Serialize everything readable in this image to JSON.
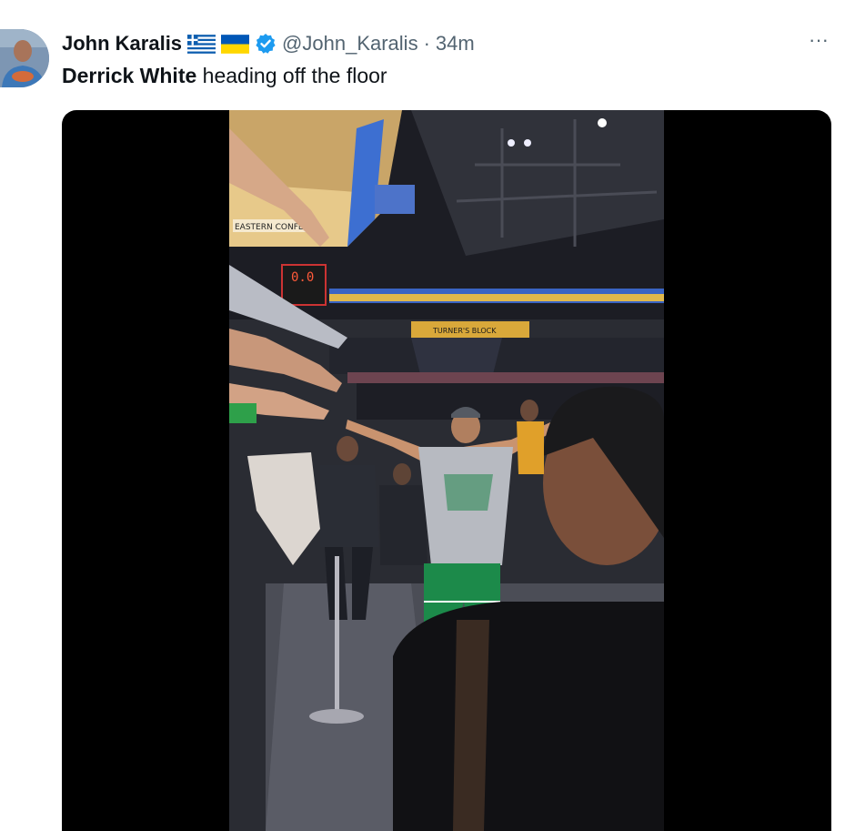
{
  "tweet": {
    "author_name": "John Karalis",
    "handle": "@John_Karalis",
    "separator": "·",
    "time": "34m",
    "text_bold": "Derrick White",
    "text_rest": " heading off the floor",
    "more_label": "···"
  },
  "media": {
    "scoreboard_text": "0.0",
    "banner_text": "EASTERN CONFE",
    "sign_text": "TURNER'S BLOCK"
  },
  "icons": {
    "flag_1": "greece-flag-icon",
    "flag_2": "ukraine-flag-icon",
    "verified": "verified-badge-icon",
    "more": "more-options-icon"
  },
  "colors": {
    "verified_blue": "#1d9bf0",
    "greece_blue": "#0d5eaf",
    "ukraine_blue": "#0057b7",
    "ukraine_yellow": "#ffd700"
  }
}
